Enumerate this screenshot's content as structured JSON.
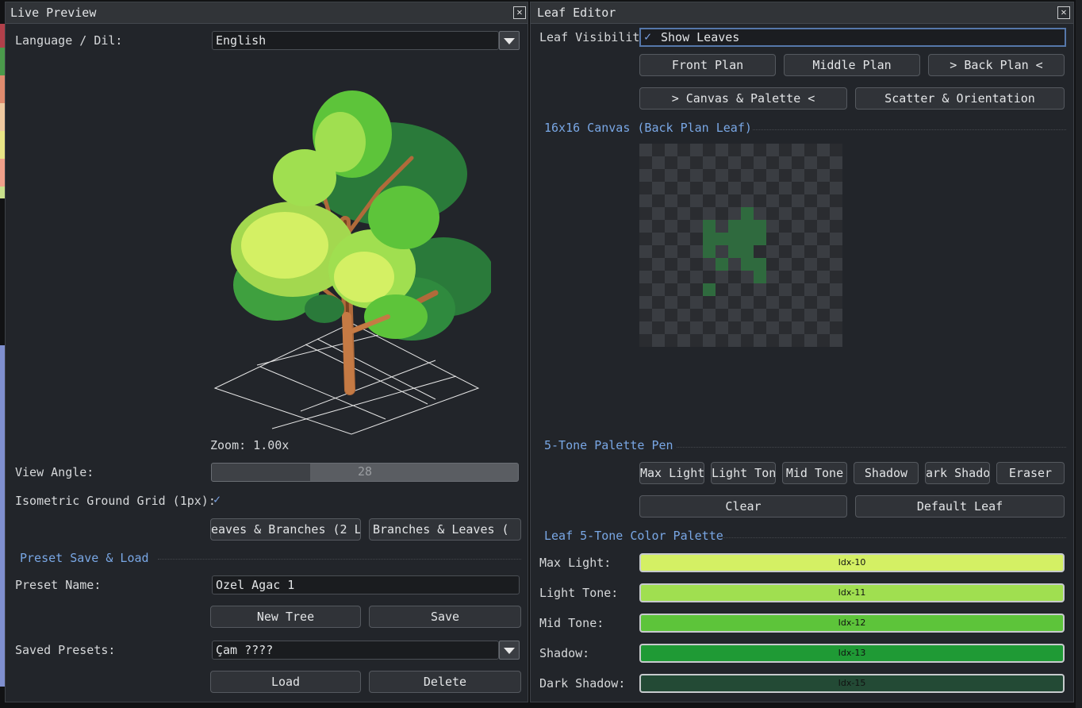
{
  "colors": {
    "accent": "#79a7e5",
    "panel_bg": "#22252a"
  },
  "live_preview": {
    "title": "Live Preview",
    "close_icon": "close-icon",
    "language_label": "Language / Dil:",
    "language_value": "English",
    "zoom_text": "Zoom: 1.00x",
    "view_angle_label": "View Angle:",
    "view_angle_value": "28",
    "view_angle_fraction": 0.32,
    "grid_label": "Isometric Ground Grid (1px):",
    "grid_checked": "✓",
    "leaves_branches_button": "eaves & Branches (2 L",
    "branches_leaves_button": "Branches & Leaves (",
    "preset_section": "Preset Save & Load",
    "preset_name_label": "Preset Name:",
    "preset_name_value": "Ozel Agac 1",
    "new_tree_button": "New Tree",
    "save_button": "Save",
    "saved_presets_label": "Saved Presets:",
    "saved_presets_value": "Çam ????",
    "load_button": "Load",
    "delete_button": "Delete"
  },
  "leaf_editor": {
    "title": "Leaf Editor",
    "visibility_label": "Leaf Visibility:",
    "show_leaves_check": "✓",
    "show_leaves_label": "Show Leaves",
    "front_plan": "Front Plan",
    "middle_plan": "Middle Plan",
    "back_plan": "> Back Plan <",
    "canvas_palette": "> Canvas & Palette <",
    "scatter_orientation": "Scatter & Orientation",
    "canvas_section": "16x16 Canvas (Back Plan Leaf)",
    "pen_section": "5-Tone Palette Pen",
    "pen_buttons": [
      "Max Light",
      "Light Tone",
      "Mid Tone",
      "Shadow",
      "ark Shado",
      "Eraser"
    ],
    "clear_button": "Clear",
    "default_leaf_button": "Default Leaf",
    "palette_section": "Leaf 5-Tone Color Palette",
    "palette": [
      {
        "label": "Max Light:",
        "idx": "Idx-10",
        "color": "#d4f064"
      },
      {
        "label": "Light Tone:",
        "idx": "Idx-11",
        "color": "#a0df50"
      },
      {
        "label": "Mid Tone:",
        "idx": "Idx-12",
        "color": "#5dc43a"
      },
      {
        "label": "Shadow:",
        "idx": "Idx-13",
        "color": "#1f9a35"
      },
      {
        "label": "Dark Shadow:",
        "idx": "Idx-15",
        "color": "#234a35"
      }
    ]
  }
}
